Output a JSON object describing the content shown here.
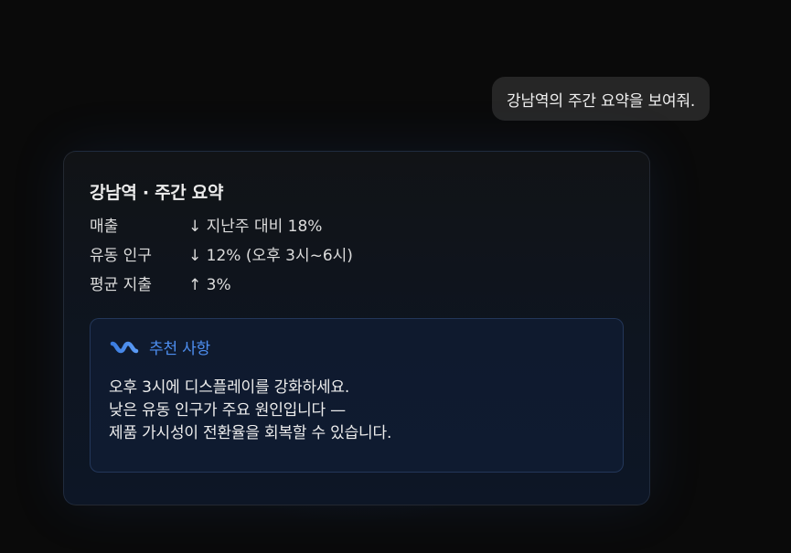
{
  "chat": {
    "user_message": "강남역의 주간 요약을 보여줘."
  },
  "summary_card": {
    "title": "강남역 · 주간 요약",
    "metrics": [
      {
        "label": "매출",
        "value": "↓ 지난주 대비 18%"
      },
      {
        "label": "유동 인구",
        "value": "↓ 12% (오후 3시~6시)"
      },
      {
        "label": "평균 지출",
        "value": "↑ 3%"
      }
    ],
    "recommendation": {
      "icon": "wave-icon",
      "title": "추천 사항",
      "lines": [
        "오후 3시에 디스플레이를 강화하세요.",
        "낮은 유동 인구가 주요 원인입니다 —",
        "제품 가시성이 전환율을 회복할 수 있습니다."
      ]
    }
  },
  "colors": {
    "background": "#0a0a0a",
    "bubble": "#262626",
    "accent": "#4d8ef0"
  }
}
